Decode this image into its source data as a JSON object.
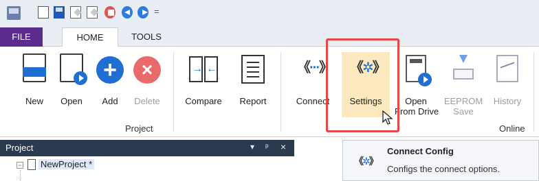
{
  "qat": {
    "app_icon": "app-logo-icon",
    "buttons": [
      "new-file-icon",
      "save-icon",
      "edit-icon",
      "edit-config-icon",
      "stop-icon",
      "back-icon",
      "forward-icon"
    ],
    "customize": "="
  },
  "tabs": {
    "file": "FILE",
    "home": "HOME",
    "tools": "TOOLS"
  },
  "ribbon": {
    "project_group": {
      "label": "Project",
      "buttons": {
        "new": "New",
        "open": "Open",
        "add": "Add",
        "delete": "Delete",
        "compare": "Compare",
        "report": "Report"
      }
    },
    "online_group": {
      "label": "Online",
      "buttons": {
        "connect": "Connect",
        "settings": "Settings",
        "open_from_drive_line1": "Open",
        "open_from_drive_line2": "From Drive",
        "eeprom_line1": "EEPROM",
        "eeprom_line2": "Save",
        "history": "History"
      }
    }
  },
  "project_pane": {
    "title": "Project",
    "controls": [
      "▾",
      "ᵖ",
      "×"
    ],
    "tree_root": "NewProject *"
  },
  "tooltip": {
    "title": "Connect Config",
    "description": "Configs the connect options."
  },
  "colors": {
    "file_tab": "#5b2b8e",
    "highlight": "#fde9bf",
    "annotation_box": "#e84646",
    "pane_header": "#2b3a4e",
    "accent_blue": "#1e6fd1"
  }
}
